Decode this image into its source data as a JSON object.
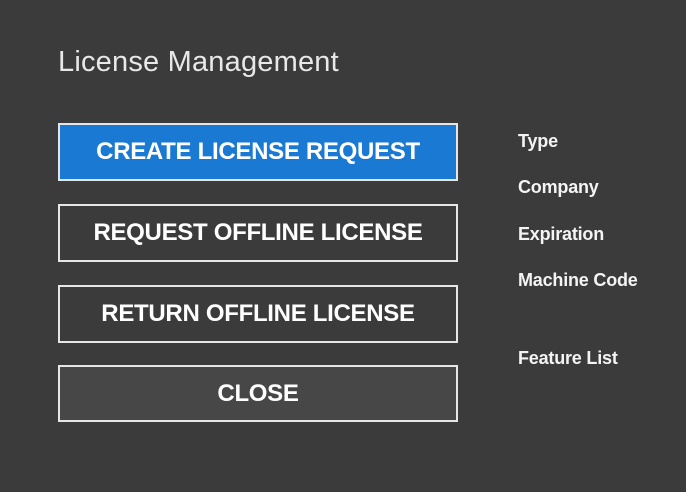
{
  "dialog": {
    "title": "License Management"
  },
  "buttons": {
    "create_license_request": "CREATE LICENSE REQUEST",
    "request_offline_license": "REQUEST OFFLINE LICENSE",
    "return_offline_license": "RETURN OFFLINE LICENSE",
    "close": "CLOSE"
  },
  "license_info": {
    "labels": {
      "type": "Type",
      "company": "Company",
      "expiration": "Expiration",
      "machine_code": "Machine Code",
      "feature_list": "Feature List"
    }
  },
  "colors": {
    "background": "#3b3b3b",
    "primary_button": "#1a79d3",
    "close_button": "#474747",
    "button_border": "#e6e6e6",
    "text": "#ffffff"
  }
}
